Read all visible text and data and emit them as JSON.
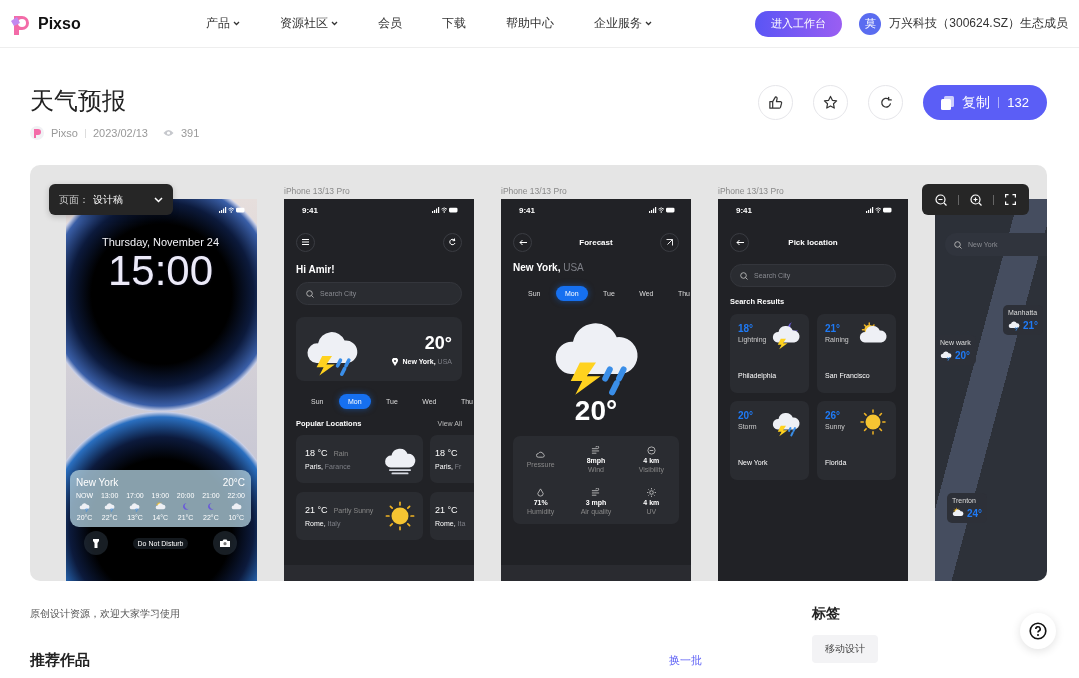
{
  "header": {
    "logo": "Pixso",
    "nav": [
      {
        "label": "产品",
        "dropdown": true
      },
      {
        "label": "资源社区",
        "dropdown": true
      },
      {
        "label": "会员",
        "dropdown": false
      },
      {
        "label": "下载",
        "dropdown": false
      },
      {
        "label": "帮助中心",
        "dropdown": false
      },
      {
        "label": "企业服务",
        "dropdown": true
      }
    ],
    "cta": "进入工作台",
    "partner_avatar": "莫",
    "partner": "万兴科技（300624.SZ）生态成员"
  },
  "work": {
    "title": "天气预报",
    "author": "Pixso",
    "date": "2023/02/13",
    "views": "391",
    "copy_label": "复制",
    "copy_count": "132"
  },
  "preview": {
    "page_select": {
      "label": "页面：",
      "value": "设计稿"
    },
    "lock_screen": {
      "date": "Thursday, November 24",
      "time": "15:00",
      "widget": {
        "city": "New York",
        "temp": "20°C",
        "hours": [
          {
            "time": "NOW",
            "temp": "20°C"
          },
          {
            "time": "13:00",
            "temp": "22°C"
          },
          {
            "time": "17:00",
            "temp": "13°C"
          },
          {
            "time": "19:00",
            "temp": "14°C"
          },
          {
            "time": "20:00",
            "temp": "21°C"
          },
          {
            "time": "21:00",
            "temp": "22°C"
          },
          {
            "time": "22:00",
            "temp": "10°C"
          }
        ]
      },
      "focus": "Do Not Disturb"
    },
    "home_screen": {
      "label": "iPhone 13/13 Pro",
      "time": "9:41",
      "greeting": "Hi Amir!",
      "search_placeholder": "Search City",
      "current": {
        "temp": "20°",
        "city": "New York,",
        "country": "USA"
      },
      "days": [
        {
          "label": "Sun",
          "selected": false
        },
        {
          "label": "Mon",
          "selected": true
        },
        {
          "label": "Tue",
          "selected": false
        },
        {
          "label": "Wed",
          "selected": false
        },
        {
          "label": "Thu",
          "selected": false
        }
      ],
      "section": "Popular Locations",
      "view_all": "View All",
      "locations": [
        {
          "temp": "18 °C",
          "condition": "Rain",
          "city": "Paris,",
          "country": "Farance"
        },
        {
          "temp": "18 °C",
          "city": "Paris,",
          "country": "Fr"
        },
        {
          "temp": "21 °C",
          "condition": "Partly Sunny",
          "city": "Rome,",
          "country": "Italy"
        },
        {
          "temp": "21 °C",
          "city": "Rome,",
          "country": "Ita"
        }
      ]
    },
    "forecast_screen": {
      "label": "iPhone 13/13 Pro",
      "time": "9:41",
      "title": "Forecast",
      "city": "New York,",
      "country": "USA",
      "days": [
        {
          "label": "Sun",
          "selected": false
        },
        {
          "label": "Mon",
          "selected": true
        },
        {
          "label": "Tue",
          "selected": false
        },
        {
          "label": "Wed",
          "selected": false
        },
        {
          "label": "Thu",
          "selected": false
        }
      ],
      "temp": "20°",
      "stats": [
        {
          "label": "Pressure"
        },
        {
          "value": "8mph",
          "label": "Wind"
        },
        {
          "value": "4 km",
          "label": "Visibility"
        },
        {
          "value": "71%",
          "label": "Humidity"
        },
        {
          "value": "3 mph",
          "label": "Air quality"
        },
        {
          "value": "4 km",
          "label": "UV"
        }
      ]
    },
    "pick_screen": {
      "label": "iPhone 13/13 Pro",
      "time": "9:41",
      "title": "Pick location",
      "search_placeholder": "Search City",
      "section": "Search Results",
      "results": [
        {
          "temp": "18°",
          "condition": "Lightning",
          "city": "Philadelphia"
        },
        {
          "temp": "21°",
          "condition": "Raining",
          "city": "San Francisco"
        },
        {
          "temp": "20°",
          "condition": "Storm",
          "city": "New York"
        },
        {
          "temp": "26°",
          "condition": "Sunny",
          "city": "Florida"
        }
      ]
    },
    "map_screen": {
      "search_placeholder": "New York",
      "pins": [
        {
          "city": "Manhatta",
          "temp": "21°"
        },
        {
          "city": "New wark",
          "temp": "20°"
        },
        {
          "city": "Trenton",
          "temp": "24°"
        }
      ]
    }
  },
  "description": "原创设计资源，欢迎大家学习使用",
  "tags_title": "标签",
  "tags": [
    "移动设计"
  ],
  "recommended": {
    "title": "推荐作品",
    "refresh": "换一批"
  }
}
